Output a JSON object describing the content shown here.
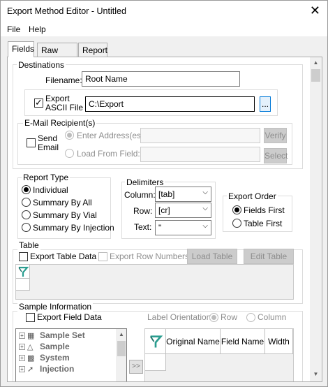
{
  "window": {
    "title": "Export Method Editor - Untitled",
    "close_glyph": "✕"
  },
  "menu": {
    "file": "File",
    "help": "Help"
  },
  "tabs": [
    "Fields",
    "Raw Data",
    "Report"
  ],
  "destinations": {
    "group_label": "Destinations",
    "filename_label": "Filename:",
    "filename_value": "Root Name",
    "export_ascii_label_line1": "Export",
    "export_ascii_label_line2": "ASCII File",
    "export_ascii_checked": true,
    "ascii_path": "C:\\Export",
    "browse_label": "...",
    "email": {
      "group_label": "E-Mail Recipient(s)",
      "send_email_line1": "Send",
      "send_email_line2": "Email",
      "enter_address_label": "Enter Address(es):",
      "load_from_field_label": "Load From Field:",
      "verify_label": "Verify",
      "select_label": "Select"
    }
  },
  "report_type": {
    "group_label": "Report Type",
    "options": [
      "Individual",
      "Summary By All",
      "Summary By Vial",
      "Summary By Injection"
    ],
    "selected_index": 0
  },
  "delimiters": {
    "group_label": "Delimiters",
    "column_label": "Column:",
    "column_value": "[tab]",
    "row_label": "Row:",
    "row_value": "[cr]",
    "text_label": "Text:",
    "text_value": "\""
  },
  "export_order": {
    "group_label": "Export Order",
    "options": [
      "Fields First",
      "Table First"
    ],
    "selected_index": 0
  },
  "table": {
    "group_label": "Table",
    "export_table_data_label": "Export Table Data",
    "export_row_numbers_label": "Export Row Numbers",
    "load_table_label": "Load Table",
    "edit_table_label": "Edit Table"
  },
  "sample_info": {
    "group_label": "Sample Information",
    "export_field_data_label": "Export Field Data",
    "label_orientation_label": "Label Orientation:",
    "orientation_row": "Row",
    "orientation_column": "Column",
    "tree_items": [
      "Sample Set",
      "Sample",
      "System",
      "Injection"
    ],
    "move_button_label": ">>",
    "grid_headers": [
      "Original Name",
      "Field Name",
      "Width"
    ]
  },
  "colors": {
    "accent": "#0078d7",
    "grid_icon": "#2a9d8f"
  }
}
